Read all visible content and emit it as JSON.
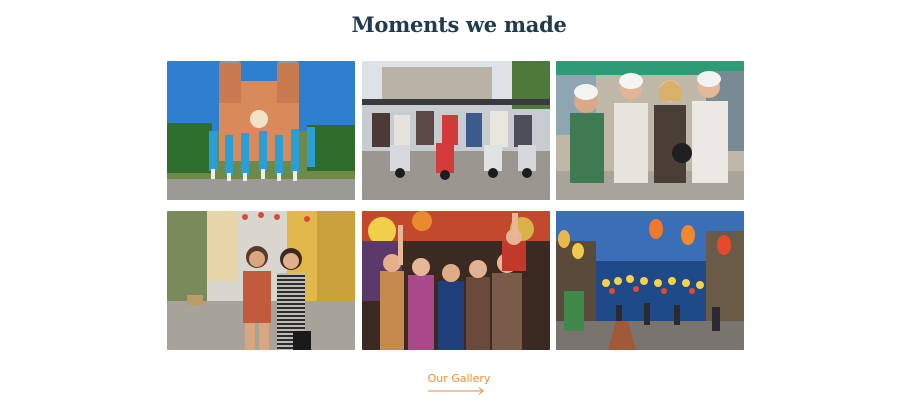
{
  "section": {
    "title": "Moments we made"
  },
  "gallery": {
    "photos": [
      {
        "name": "cathedral-group-photo"
      },
      {
        "name": "motorbike-group-photo"
      },
      {
        "name": "helmet-friends-photo"
      },
      {
        "name": "street-women-photo"
      },
      {
        "name": "party-group-photo"
      },
      {
        "name": "lantern-street-photo"
      }
    ]
  },
  "cta": {
    "label": "Our Gallery",
    "accent": "#ef8c2c"
  },
  "colors": {
    "title": "#1f3b4d"
  }
}
